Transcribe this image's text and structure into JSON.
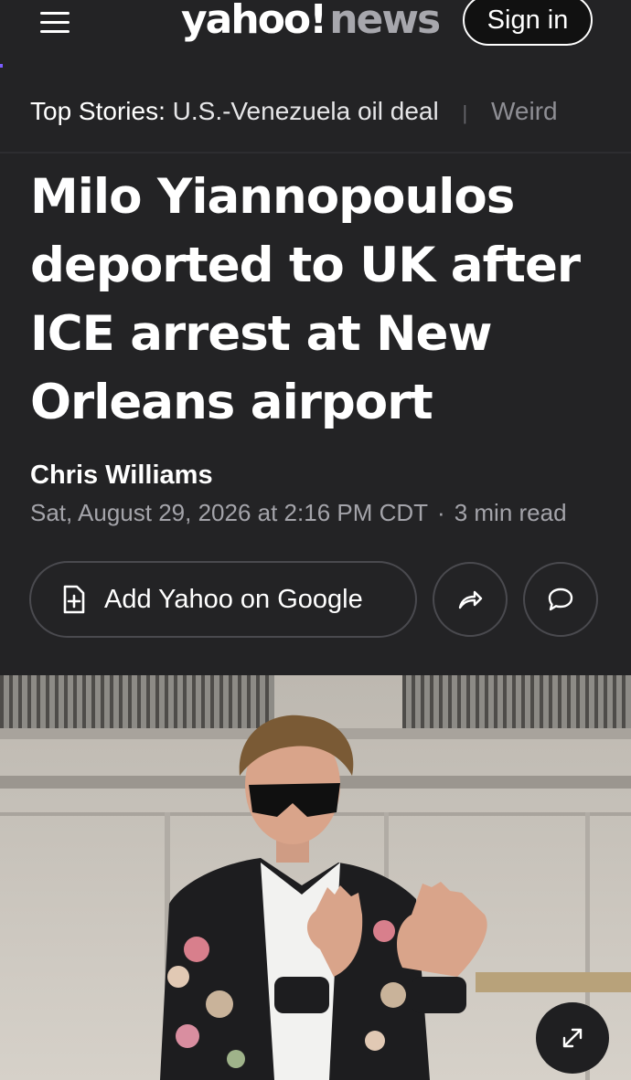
{
  "header": {
    "logo_primary": "yahoo!",
    "logo_secondary": "news",
    "signin_label": "Sign in",
    "menu_icon": "hamburger-menu-icon"
  },
  "top_stories": {
    "label": "Top Stories:",
    "items": [
      "U.S.-Venezuela oil deal",
      "Weird"
    ]
  },
  "article": {
    "headline": "Milo Yiannopoulos deported to UK after ICE arrest at New Orleans airport",
    "author": "Chris Williams",
    "date": "Sat, August 29, 2026 at 2:16 PM CDT",
    "read_time": "3 min read"
  },
  "actions": {
    "add_google_label": "Add Yahoo on Google",
    "add_icon": "add-document-icon",
    "share_icon": "share-arrow-icon",
    "comment_icon": "comment-bubble-icon"
  },
  "photo": {
    "expand_icon": "expand-arrows-icon"
  },
  "colors": {
    "background": "#232325",
    "text": "#ffffff",
    "muted": "#a4a4aa",
    "border": "#4a4a4f",
    "accent": "#7a5cff"
  }
}
